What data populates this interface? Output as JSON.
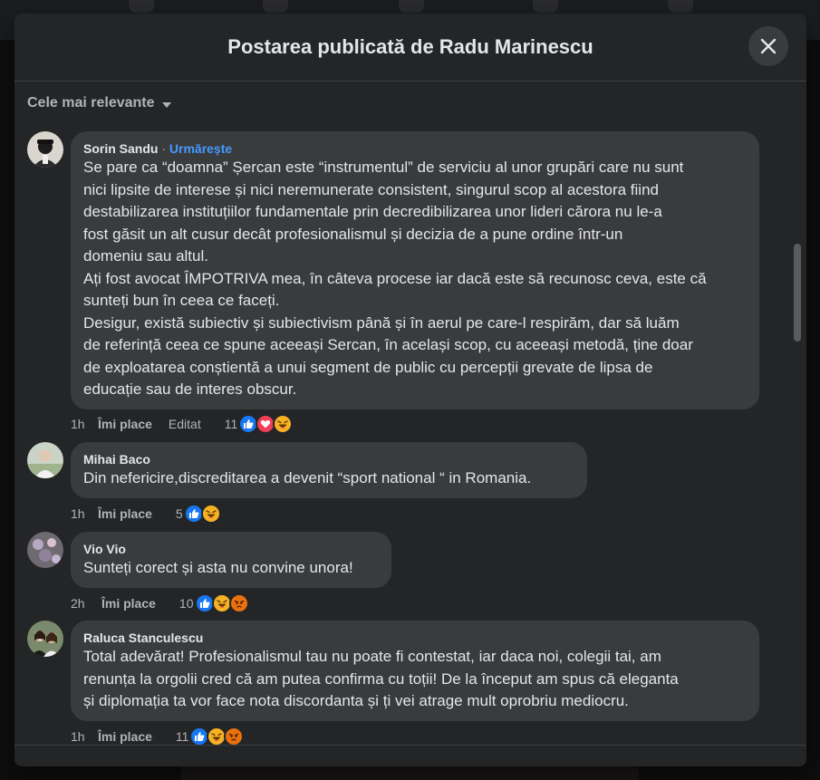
{
  "modal": {
    "title": "Postarea publicată de Radu Marinescu"
  },
  "sort": {
    "label": "Cele mai relevante"
  },
  "comments": [
    {
      "author": "Sorin Sandu",
      "follow": "Urmărește",
      "text": "Se pare ca “doamna” Șercan este “instrumentul” de serviciu al unor grupări care nu sunt\nnici lipsite de interese și nici neremunerate consistent, singurul scop al acestora fiind\ndestabilizarea instituțiilor fundamentale prin decredibilizarea unor lideri cărora nu le-a\nfost găsit un alt cusur decât profesionalismul și decizia de a pune ordine într-un\ndomeniu sau altul.\nAți fost avocat ÎMPOTRIVA mea, în câteva procese iar dacă este să recunosc ceva, este că\nsunteți bun în ceea ce faceți.\nDesigur, există subiectiv și subiectivism până și în aerul pe care-l respirăm, dar să luăm\nde referință ceea ce spune aceeași Sercan, în același scop, cu aceeași metodă, ține doar\nde exploatarea conștientă a unui segment de public cu percepții grevate de lipsa de\neducație sau de interes obscur.",
      "time": "1h",
      "like": "Îmi place",
      "edited": "Editat",
      "reaction_count": "11",
      "reactions": [
        "like",
        "love",
        "haha"
      ]
    },
    {
      "author": "Mihai Baco",
      "text": "Din nefericire,discreditarea a devenit “sport national “ in Romania.",
      "time": "1h",
      "like": "Îmi place",
      "reaction_count": "5",
      "reactions": [
        "like",
        "haha"
      ]
    },
    {
      "author": "Vio Vio",
      "text": "Sunteți corect și asta nu convine unora!",
      "time": "2h",
      "like": "Îmi place",
      "reaction_count": "10",
      "reactions": [
        "like",
        "haha",
        "angry"
      ]
    },
    {
      "author": "Raluca Stanculescu",
      "text": "Total adevărat! Profesionalismul tau nu poate fi contestat, iar daca noi, colegii tai, am\nrenunța la orgolii cred că am putea confirma cu toții! De la început am spus că eleganta\nși diplomația ta vor face nota discordanta și ți vei atrage mult oprobriu mediocru.",
      "time": "1h",
      "like": "Îmi place",
      "reaction_count": "11",
      "reactions": [
        "like",
        "haha",
        "angry"
      ]
    }
  ],
  "colors": {
    "modal_bg": "#242526",
    "bubble_bg": "#3a3b3c",
    "accent_link": "#4599ff",
    "like_blue": "#1877f2",
    "love_red": "#f33e58",
    "haha_yellow": "#f7b125",
    "angry_orange": "#e9710f"
  },
  "icons": {
    "close": "close-icon",
    "sort": "caret-down-icon",
    "reactions": [
      "like-reaction-icon",
      "love-reaction-icon",
      "haha-reaction-icon",
      "angry-reaction-icon"
    ]
  }
}
